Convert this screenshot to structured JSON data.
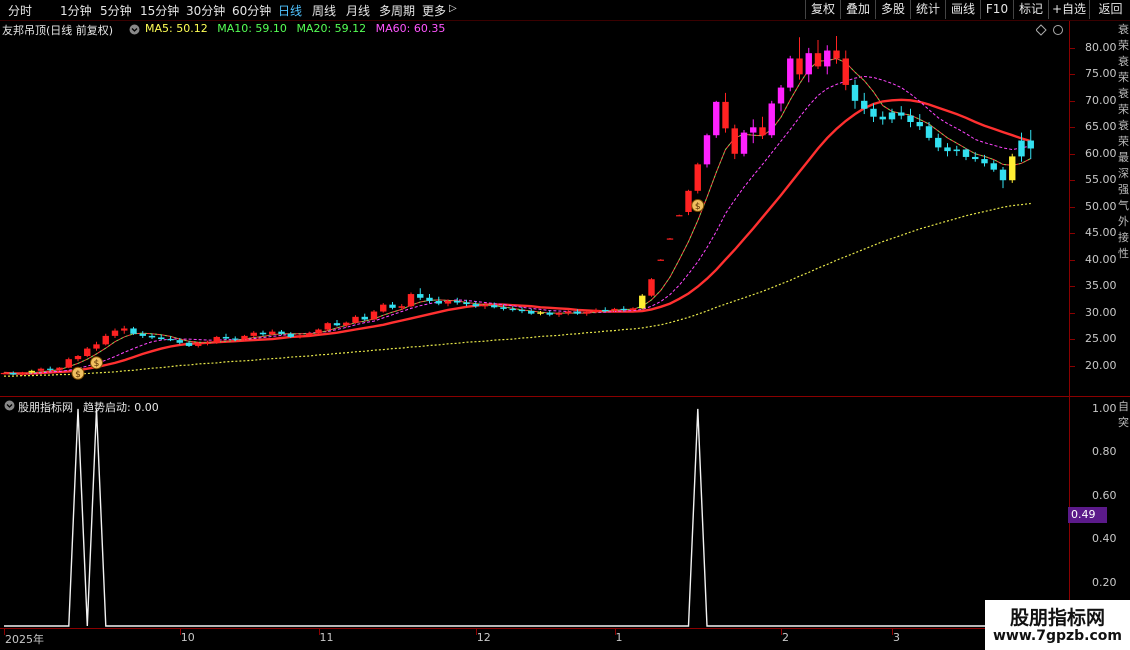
{
  "toolbar": {
    "periods": [
      "分时",
      "1分钟",
      "5分钟",
      "15分钟",
      "30分钟",
      "60分钟",
      "日线",
      "周线",
      "月线",
      "多周期",
      "更多"
    ],
    "active_period": "日线",
    "more_arrow": "▷",
    "right_buttons": [
      "复权",
      "叠加",
      "多股",
      "统计",
      "画线",
      "F10",
      "标记",
      "+自选",
      "返回"
    ]
  },
  "main_chart": {
    "title": "友邦吊顶(日线 前复权)",
    "ma_legend": [
      {
        "label": "MA5: 50.12",
        "color": "#ffff55"
      },
      {
        "label": "MA10: 59.10",
        "color": "#55ff55"
      },
      {
        "label": "MA20: 59.12",
        "color": "#55ff55"
      },
      {
        "label": "MA60: 60.35",
        "color": "#ff55ff"
      }
    ],
    "y_ticks": [
      "80.00",
      "75.00",
      "70.00",
      "65.00",
      "60.00",
      "55.00",
      "50.00",
      "45.00",
      "40.00",
      "35.00",
      "30.00",
      "25.00",
      "20.00"
    ],
    "right_vertical_text": "衰荣衰荣衰荣衰荣最深强气外接性"
  },
  "sub_chart": {
    "title": "股朋指标网",
    "indicator": "趋势启动: 0.00",
    "y_ticks": [
      "1.00",
      "0.80",
      "0.60",
      "0.40",
      "0.20"
    ],
    "current_value": "0.49",
    "right_vertical_text": "自突"
  },
  "x_axis": {
    "labels": [
      "2025年",
      "10",
      "11",
      "12",
      "1",
      "2",
      "3"
    ]
  },
  "watermark": {
    "line1": "股朋指标网",
    "line2": "www.7gpzb.com"
  },
  "chart_data": {
    "type": "candlestick",
    "candles": [
      [
        18.5,
        18.7,
        18.3,
        18.6
      ],
      [
        18.6,
        18.9,
        18.2,
        18.3
      ],
      [
        18.3,
        18.8,
        18.1,
        18.7
      ],
      [
        18.7,
        19.2,
        18.5,
        19.0
      ],
      [
        19.0,
        19.6,
        18.8,
        19.4
      ],
      [
        19.4,
        19.8,
        19.0,
        19.2
      ],
      [
        19.2,
        19.7,
        19.0,
        19.6
      ],
      [
        19.6,
        21.5,
        19.5,
        21.2
      ],
      [
        21.2,
        22.0,
        20.8,
        21.8
      ],
      [
        21.8,
        23.5,
        21.6,
        23.2
      ],
      [
        23.2,
        24.5,
        22.8,
        24.0
      ],
      [
        24.0,
        26.0,
        23.8,
        25.6
      ],
      [
        25.6,
        27.0,
        25.2,
        26.6
      ],
      [
        26.6,
        27.5,
        26.0,
        27.0
      ],
      [
        27.0,
        27.3,
        25.8,
        26.0
      ],
      [
        26.0,
        26.5,
        25.2,
        25.6
      ],
      [
        25.6,
        26.0,
        25.0,
        25.3
      ],
      [
        25.3,
        25.8,
        24.8,
        25.0
      ],
      [
        25.0,
        25.5,
        24.6,
        24.8
      ],
      [
        24.8,
        25.2,
        24.0,
        24.3
      ],
      [
        24.3,
        24.6,
        23.5,
        23.7
      ],
      [
        23.7,
        24.3,
        23.4,
        24.1
      ],
      [
        24.1,
        24.7,
        23.8,
        24.3
      ],
      [
        24.3,
        25.6,
        24.1,
        25.4
      ],
      [
        25.4,
        26.0,
        24.9,
        25.1
      ],
      [
        25.1,
        25.5,
        24.6,
        24.9
      ],
      [
        24.9,
        25.8,
        24.7,
        25.6
      ],
      [
        25.6,
        26.5,
        25.3,
        26.2
      ],
      [
        26.2,
        26.6,
        25.6,
        25.9
      ],
      [
        25.9,
        26.8,
        25.7,
        26.4
      ],
      [
        26.4,
        26.7,
        25.8,
        26.0
      ],
      [
        26.0,
        26.3,
        25.2,
        25.4
      ],
      [
        25.4,
        25.9,
        25.1,
        25.7
      ],
      [
        25.7,
        26.4,
        25.5,
        26.1
      ],
      [
        26.1,
        27.0,
        25.9,
        26.8
      ],
      [
        26.8,
        28.2,
        26.6,
        28.0
      ],
      [
        28.0,
        28.6,
        27.4,
        27.6
      ],
      [
        27.6,
        28.3,
        27.2,
        28.1
      ],
      [
        28.1,
        29.5,
        27.9,
        29.2
      ],
      [
        29.2,
        29.8,
        28.4,
        28.7
      ],
      [
        28.7,
        30.5,
        28.6,
        30.2
      ],
      [
        30.2,
        31.8,
        30.0,
        31.5
      ],
      [
        31.5,
        32.0,
        30.6,
        30.9
      ],
      [
        30.9,
        31.6,
        30.5,
        31.2
      ],
      [
        31.2,
        33.8,
        31.0,
        33.5
      ],
      [
        33.5,
        34.6,
        32.4,
        32.8
      ],
      [
        32.8,
        33.5,
        31.8,
        32.2
      ],
      [
        32.2,
        33.0,
        31.4,
        31.7
      ],
      [
        31.7,
        32.5,
        31.2,
        32.2
      ],
      [
        32.2,
        32.8,
        31.5,
        31.9
      ],
      [
        31.9,
        32.4,
        31.2,
        31.6
      ],
      [
        31.6,
        32.1,
        30.9,
        31.2
      ],
      [
        31.2,
        31.8,
        30.7,
        31.4
      ],
      [
        31.4,
        31.9,
        30.8,
        31.0
      ],
      [
        31.0,
        31.5,
        30.4,
        30.7
      ],
      [
        30.7,
        31.2,
        30.2,
        30.5
      ],
      [
        30.5,
        31.0,
        29.9,
        30.3
      ],
      [
        30.3,
        30.7,
        29.6,
        29.8
      ],
      [
        29.8,
        30.3,
        29.5,
        30.0
      ],
      [
        30.0,
        30.4,
        29.3,
        29.6
      ],
      [
        29.6,
        30.1,
        29.2,
        29.9
      ],
      [
        29.9,
        30.5,
        29.5,
        30.2
      ],
      [
        30.2,
        30.6,
        29.6,
        29.8
      ],
      [
        29.8,
        30.3,
        29.4,
        30.1
      ],
      [
        30.1,
        30.8,
        29.9,
        30.5
      ],
      [
        30.5,
        31.0,
        30.1,
        30.4
      ],
      [
        30.4,
        30.9,
        30.0,
        30.7
      ],
      [
        30.7,
        31.2,
        30.2,
        30.5
      ],
      [
        30.5,
        31.0,
        30.2,
        30.8
      ],
      [
        30.8,
        33.5,
        30.6,
        33.2
      ],
      [
        33.2,
        36.5,
        33.0,
        36.3
      ],
      [
        40.0,
        40.1,
        39.9,
        40.0
      ],
      [
        44.0,
        44.1,
        43.9,
        44.0
      ],
      [
        48.4,
        48.5,
        48.3,
        48.4
      ],
      [
        49.0,
        53.2,
        48.4,
        53.0
      ],
      [
        53.0,
        58.3,
        52.5,
        58.0
      ],
      [
        58.0,
        63.8,
        57.4,
        63.5
      ],
      [
        63.5,
        70.0,
        63.0,
        69.8
      ],
      [
        69.8,
        71.5,
        64.0,
        64.8
      ],
      [
        64.8,
        65.5,
        59.0,
        60.0
      ],
      [
        60.0,
        64.5,
        59.5,
        64.0
      ],
      [
        64.0,
        66.5,
        62.0,
        65.0
      ],
      [
        65.0,
        67.0,
        62.8,
        63.5
      ],
      [
        63.5,
        70.0,
        63.0,
        69.5
      ],
      [
        69.5,
        73.0,
        68.0,
        72.5
      ],
      [
        72.5,
        78.5,
        71.8,
        78.0
      ],
      [
        78.0,
        82.0,
        74.0,
        75.0
      ],
      [
        75.0,
        80.0,
        73.5,
        79.0
      ],
      [
        79.0,
        81.5,
        76.0,
        76.5
      ],
      [
        76.5,
        80.5,
        75.0,
        79.5
      ],
      [
        79.5,
        82.5,
        77.0,
        78.0
      ],
      [
        78.0,
        79.5,
        72.0,
        73.0
      ],
      [
        73.0,
        74.0,
        68.5,
        70.0
      ],
      [
        70.0,
        71.5,
        67.5,
        68.5
      ],
      [
        68.5,
        69.5,
        66.0,
        67.0
      ],
      [
        67.0,
        68.0,
        65.5,
        66.5
      ],
      [
        66.5,
        68.5,
        65.8,
        67.8
      ],
      [
        67.8,
        69.0,
        66.5,
        67.2
      ],
      [
        67.2,
        68.5,
        65.0,
        66.0
      ],
      [
        66.0,
        67.5,
        64.5,
        65.2
      ],
      [
        65.2,
        66.0,
        62.5,
        63.0
      ],
      [
        63.0,
        63.8,
        60.5,
        61.2
      ],
      [
        61.2,
        62.0,
        59.5,
        60.5
      ],
      [
        60.5,
        61.5,
        59.6,
        60.8
      ],
      [
        60.8,
        61.0,
        58.8,
        59.4
      ],
      [
        59.4,
        60.3,
        58.5,
        59.0
      ],
      [
        59.0,
        59.8,
        57.6,
        58.2
      ],
      [
        58.2,
        58.8,
        56.6,
        57.0
      ],
      [
        57.0,
        57.5,
        53.5,
        55.0
      ],
      [
        55.0,
        60.0,
        54.5,
        59.5
      ],
      [
        59.5,
        64.0,
        58.5,
        62.5
      ],
      [
        62.5,
        64.5,
        59.0,
        61.0
      ]
    ],
    "signal_indices": [
      8,
      10,
      75
    ],
    "ma5": [
      18.6,
      18.5,
      18.5,
      18.6,
      18.8,
      19.0,
      19.2,
      19.8,
      20.4,
      21.2,
      22.2,
      23.3,
      24.5,
      25.4,
      26.0,
      26.1,
      26.0,
      25.8,
      25.5,
      25.0,
      24.6,
      24.4,
      24.3,
      24.4,
      24.6,
      24.7,
      25.0,
      25.3,
      25.5,
      25.8,
      26.0,
      26.0,
      26.0,
      26.0,
      26.2,
      26.6,
      27.1,
      27.6,
      28.1,
      28.4,
      28.8,
      29.5,
      30.1,
      30.6,
      31.4,
      32.0,
      32.3,
      32.4,
      32.3,
      32.2,
      31.9,
      31.7,
      31.5,
      31.3,
      31.1,
      30.8,
      30.5,
      30.3,
      30.1,
      29.9,
      29.9,
      29.9,
      29.9,
      29.9,
      30.1,
      30.3,
      30.4,
      30.6,
      30.6,
      31.2,
      32.4,
      34.2,
      36.7,
      40.0,
      43.4,
      47.4,
      51.8,
      56.5,
      60.8,
      63.0,
      63.7,
      63.5,
      63.4,
      64.6,
      66.9,
      70.2,
      73.2,
      75.9,
      77.5,
      77.6,
      78.0,
      77.2,
      75.4,
      73.8,
      71.7,
      69.1,
      68.0,
      67.6,
      67.3,
      66.5,
      65.6,
      64.3,
      63.0,
      62.0,
      61.0,
      60.0,
      59.5,
      58.9,
      58.0,
      57.8,
      58.2,
      59.1
    ],
    "ma10": [
      18.6,
      18.5,
      18.5,
      18.5,
      18.6,
      18.8,
      18.9,
      19.1,
      19.5,
      19.9,
      20.4,
      21.0,
      21.7,
      22.5,
      23.2,
      23.9,
      24.5,
      24.8,
      25.0,
      25.0,
      25.0,
      24.9,
      24.8,
      24.8,
      24.9,
      24.9,
      24.9,
      25.1,
      25.3,
      25.5,
      25.7,
      25.9,
      26.0,
      26.1,
      26.3,
      26.4,
      26.8,
      27.2,
      27.7,
      28.1,
      28.4,
      29.0,
      29.6,
      30.2,
      30.8,
      31.3,
      31.7,
      32.0,
      32.2,
      32.4,
      32.3,
      32.1,
      31.9,
      31.7,
      31.5,
      31.3,
      31.0,
      30.8,
      30.6,
      30.4,
      30.3,
      30.2,
      30.1,
      30.0,
      30.0,
      30.1,
      30.2,
      30.3,
      30.4,
      30.6,
      31.2,
      32.1,
      33.4,
      35.2,
      37.3,
      39.6,
      42.3,
      45.3,
      48.7,
      51.3,
      53.7,
      55.9,
      58.0,
      60.2,
      62.4,
      64.6,
      66.9,
      69.1,
      71.0,
      72.3,
      73.1,
      73.7,
      74.3,
      74.6,
      74.4,
      73.9,
      73.3,
      72.5,
      71.3,
      69.9,
      68.3,
      66.8,
      65.7,
      64.8,
      63.8,
      62.7,
      62.1,
      61.6,
      61.1,
      60.8,
      61.1,
      61.5
    ],
    "ma20": [
      18.6,
      18.5,
      18.5,
      18.5,
      18.6,
      18.7,
      18.8,
      18.9,
      19.1,
      19.4,
      19.7,
      20.1,
      20.5,
      21.0,
      21.6,
      22.2,
      22.7,
      23.2,
      23.6,
      23.9,
      24.1,
      24.2,
      24.3,
      24.4,
      24.5,
      24.6,
      24.7,
      24.8,
      24.9,
      25.0,
      25.2,
      25.4,
      25.5,
      25.6,
      25.8,
      26.0,
      26.2,
      26.5,
      26.8,
      27.1,
      27.4,
      27.7,
      28.1,
      28.5,
      28.9,
      29.3,
      29.7,
      30.1,
      30.5,
      30.8,
      31.1,
      31.3,
      31.5,
      31.5,
      31.5,
      31.4,
      31.3,
      31.2,
      31.0,
      30.9,
      30.8,
      30.7,
      30.5,
      30.4,
      30.3,
      30.2,
      30.2,
      30.2,
      30.2,
      30.3,
      30.6,
      31.1,
      31.7,
      32.6,
      33.6,
      34.9,
      36.4,
      38.1,
      40.0,
      41.9,
      43.9,
      45.9,
      48.0,
      50.1,
      52.2,
      54.4,
      56.6,
      58.8,
      61.0,
      63.0,
      64.7,
      66.2,
      67.5,
      68.6,
      69.4,
      69.9,
      70.1,
      70.2,
      70.1,
      69.8,
      69.3,
      68.7,
      68.1,
      67.5,
      66.8,
      66.0,
      65.3,
      64.7,
      64.1,
      63.5,
      62.9,
      62.4
    ],
    "ma60": [
      18.0,
      18.0,
      18.1,
      18.1,
      18.2,
      18.2,
      18.3,
      18.3,
      18.4,
      18.5,
      18.6,
      18.7,
      18.8,
      19.0,
      19.1,
      19.3,
      19.5,
      19.6,
      19.8,
      20.0,
      20.1,
      20.3,
      20.4,
      20.5,
      20.7,
      20.8,
      20.9,
      21.0,
      21.2,
      21.3,
      21.4,
      21.6,
      21.7,
      21.8,
      22.0,
      22.1,
      22.3,
      22.4,
      22.6,
      22.7,
      22.9,
      23.0,
      23.2,
      23.3,
      23.5,
      23.6,
      23.8,
      23.9,
      24.1,
      24.2,
      24.4,
      24.5,
      24.6,
      24.8,
      24.9,
      25.0,
      25.2,
      25.3,
      25.5,
      25.6,
      25.7,
      25.9,
      26.0,
      26.2,
      26.3,
      26.5,
      26.6,
      26.8,
      26.9,
      27.1,
      27.4,
      27.7,
      28.1,
      28.6,
      29.1,
      29.7,
      30.3,
      31.0,
      31.6,
      32.2,
      32.8,
      33.4,
      34.0,
      34.7,
      35.4,
      36.1,
      36.9,
      37.6,
      38.4,
      39.1,
      39.9,
      40.6,
      41.3,
      42.0,
      42.7,
      43.4,
      44.0,
      44.6,
      45.2,
      45.8,
      46.3,
      46.8,
      47.3,
      47.8,
      48.3,
      48.7,
      49.1,
      49.5,
      49.9,
      50.2,
      50.4,
      50.6
    ],
    "ylim": [
      15,
      83
    ],
    "sub_ylim": [
      0,
      1.05
    ]
  }
}
